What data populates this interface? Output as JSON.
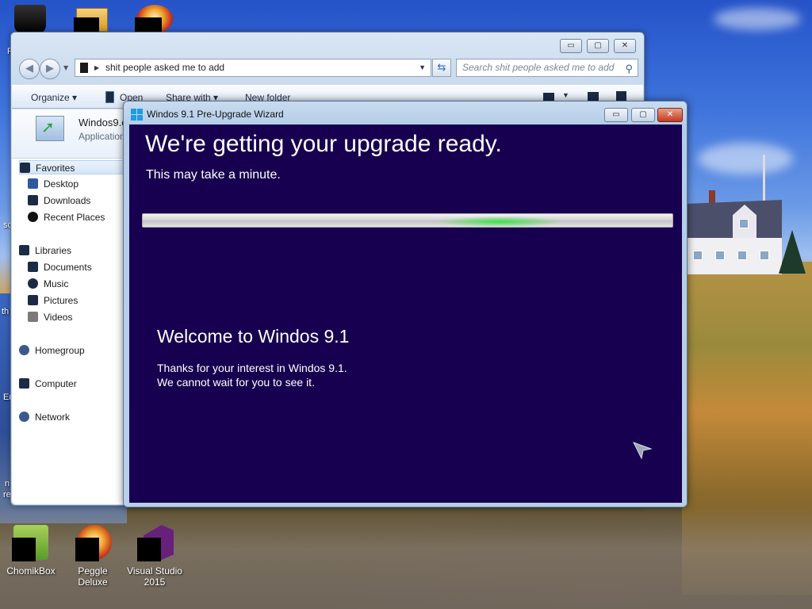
{
  "desktop": {
    "icons": [
      {
        "label": "ChomikBox",
        "icon": "chomikbox-icon"
      },
      {
        "label": "Peggle Deluxe",
        "icon": "peggle-icon"
      },
      {
        "label": "Visual Studio 2015",
        "icon": "visual-studio-icon"
      }
    ],
    "edge_fragments": [
      "F",
      "sc",
      "th",
      "Er",
      "n",
      "re"
    ]
  },
  "explorer": {
    "address": "shit people asked me to add",
    "search_placeholder": "Search shit people asked me to add",
    "controls": {
      "minimize": "▭",
      "maximize": "▢",
      "close": "✕"
    },
    "toolbar": {
      "organize": "Organize",
      "open": "Open",
      "share_with": "Share with",
      "new_folder": "New folder"
    },
    "details": {
      "name": "Windos9.e",
      "type": "Application"
    },
    "sidebar": {
      "favorites": "Favorites",
      "desktop": "Desktop",
      "downloads": "Downloads",
      "recent_places": "Recent Places",
      "libraries": "Libraries",
      "documents": "Documents",
      "music": "Music",
      "pictures": "Pictures",
      "videos": "Videos",
      "homegroup": "Homegroup",
      "computer": "Computer",
      "network": "Network"
    }
  },
  "wizard": {
    "title": "Windos 9.1 Pre-Upgrade Wizard",
    "heading": "We're getting your upgrade ready.",
    "subheading": "This may take a minute.",
    "welcome_title": "Welcome to Windos 9.1",
    "welcome_line1": "Thanks for your interest in Windos 9.1.",
    "welcome_line2": "We cannot wait for you to see it.",
    "progress_indicator": "indeterminate",
    "colors": {
      "background": "#17004f",
      "progress_glow": "#41e04b"
    }
  }
}
